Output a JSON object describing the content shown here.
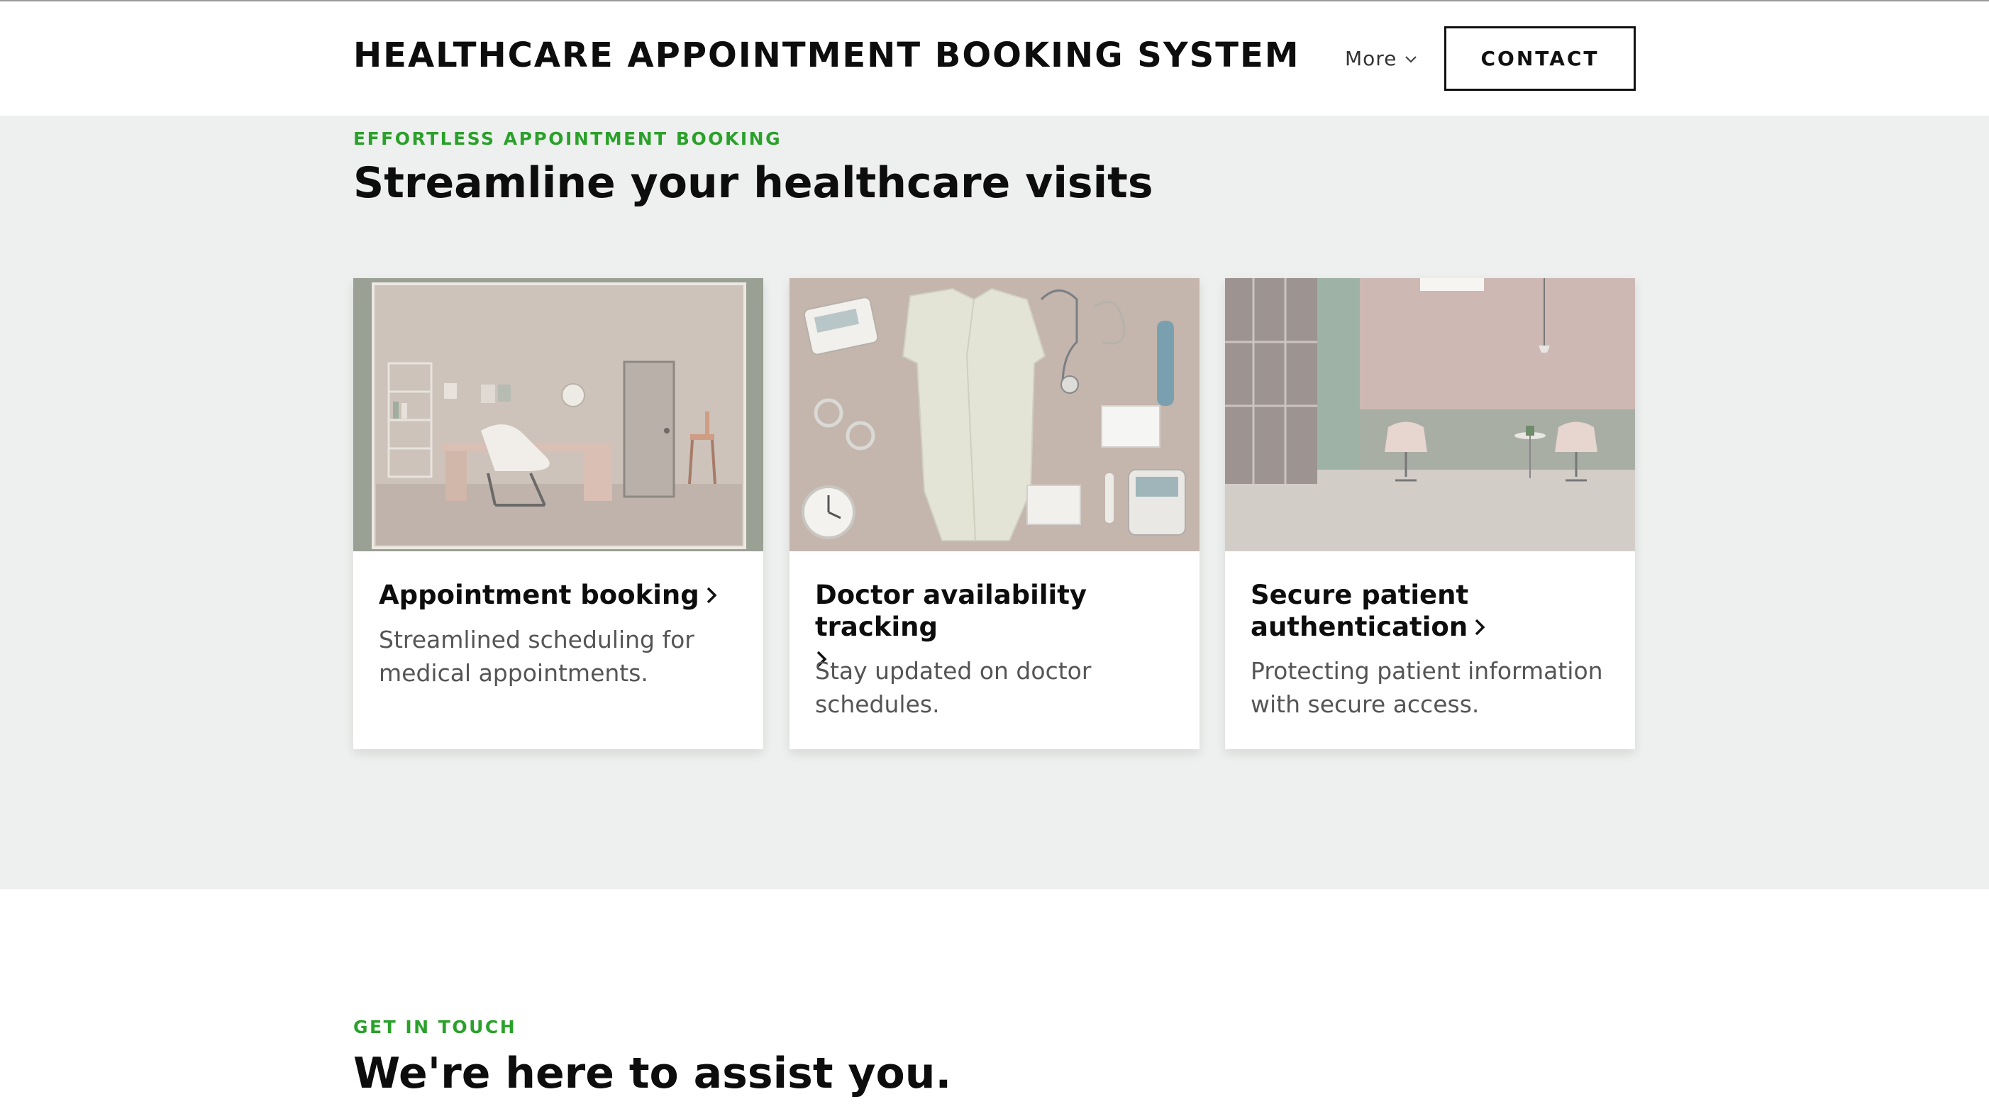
{
  "header": {
    "brand": "HEALTHCARE APPOINTMENT BOOKING SYSTEM",
    "more_label": "More",
    "contact_label": "CONTACT"
  },
  "features": {
    "eyebrow": "EFFORTLESS APPOINTMENT BOOKING",
    "title": "Streamline your healthcare visits",
    "cards": [
      {
        "title": "Appointment booking",
        "description": "Streamlined scheduling for medical appointments.",
        "image": "medical-office-room"
      },
      {
        "title": "Doctor availability tracking",
        "description": "Stay updated on doctor schedules.",
        "image": "doctor-coat-and-instruments-flatlay"
      },
      {
        "title": "Secure patient authentication",
        "description": "Protecting patient information with secure access.",
        "image": "waiting-room-with-chairs"
      }
    ]
  },
  "touch": {
    "eyebrow": "GET IN TOUCH",
    "title": "We're here to assist you."
  },
  "colors": {
    "accent_green": "#2aa12a",
    "section_bg": "#eef0ef",
    "text_dark": "#0d0d0d",
    "text_muted": "#555555"
  }
}
